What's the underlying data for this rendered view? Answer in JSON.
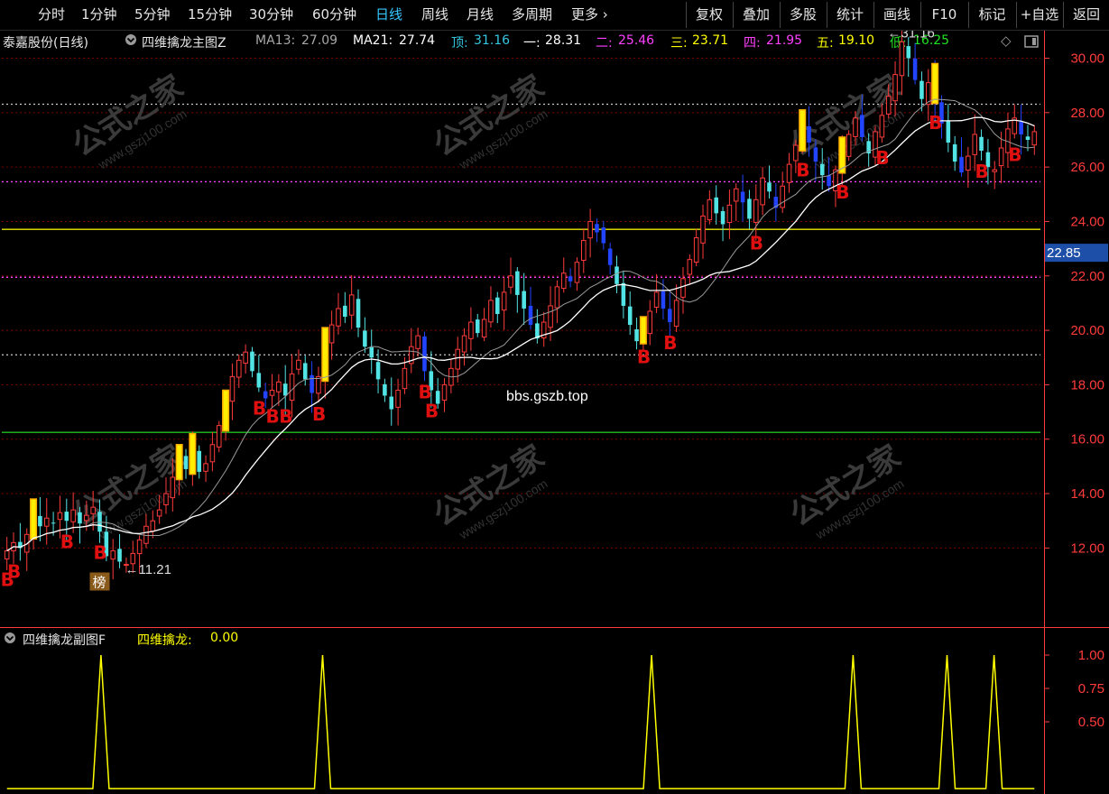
{
  "toolbar": {
    "periods": [
      "分时",
      "1分钟",
      "5分钟",
      "15分钟",
      "30分钟",
      "60分钟",
      "日线",
      "周线",
      "月线",
      "多周期",
      "更多"
    ],
    "active_period": "日线",
    "right_buttons": [
      "复权",
      "叠加",
      "多股",
      "统计",
      "画线",
      "F10",
      "标记",
      "+自选",
      "返回"
    ]
  },
  "info": {
    "stock": "泰嘉股份(日线)",
    "indicator": "四维擒龙主图Z",
    "ma13_label": "MA13:",
    "ma13_value": "27.09",
    "ma21_label": "MA21:",
    "ma21_value": "27.74",
    "top_label": "顶:",
    "top_value": "31.16",
    "l1_label": "一:",
    "l1_value": "28.31",
    "l2_label": "二:",
    "l2_value": "25.46",
    "l3_label": "三:",
    "l3_value": "23.71",
    "l4_label": "四:",
    "l4_value": "21.95",
    "l5_label": "五:",
    "l5_value": "19.10",
    "low_label": "低:",
    "low_value": "16.25"
  },
  "colors": {
    "up": "#ff3b3b",
    "down_cyan": "#52e4e4",
    "down_blue": "#2244ff",
    "yellow_line": "#e8e800",
    "green_line": "#20c020",
    "cyan_line": "#35c6e0",
    "grid_red": "#7a0000",
    "ma13": "#dcdcdc",
    "ma21": "#ffffff",
    "signal": "#ffff00",
    "axis": "#ff3b3b"
  },
  "icons": {
    "collapse": "circle-chevron-icon",
    "diamond": "diamond-icon",
    "window": "window-icon"
  },
  "chart_data": [
    {
      "type": "candlestick",
      "title": "四维擒龙主图Z",
      "ylim": [
        11.0,
        31.5
      ],
      "y_ticks": [
        "12.00",
        "14.00",
        "16.00",
        "18.00",
        "20.00",
        "22.00",
        "24.00",
        "26.00",
        "28.00",
        "30.00"
      ],
      "current_price": "22.85",
      "high_annotation": "31.16",
      "low_annotation": "11.21",
      "watermark_main": "bbs.gszb.top",
      "watermark_logo": "公式之家",
      "watermark_url": "www.gszj100.com",
      "levels": [
        {
          "name": "顶",
          "value": 31.16
        },
        {
          "name": "一",
          "value": 28.31
        },
        {
          "name": "二",
          "value": 25.46
        },
        {
          "name": "三",
          "value": 23.71
        },
        {
          "name": "四",
          "value": 21.95
        },
        {
          "name": "五",
          "value": 19.1
        },
        {
          "name": "低",
          "value": 16.25
        }
      ],
      "b_signals": [
        0,
        1,
        9,
        14,
        38,
        40,
        42,
        47,
        63,
        64,
        96,
        100,
        113,
        120,
        126,
        132,
        140,
        147,
        152
      ],
      "bang_marker": "榜",
      "bang_index": 14,
      "closes": [
        11.9,
        12.2,
        12.0,
        12.5,
        13.2,
        12.8,
        13.1,
        12.9,
        13.3,
        13.0,
        13.4,
        12.9,
        13.2,
        13.5,
        12.6,
        11.7,
        11.9,
        11.5,
        11.4,
        11.8,
        12.3,
        12.8,
        13.0,
        13.4,
        14.0,
        14.6,
        15.2,
        14.9,
        15.6,
        14.8,
        15.1,
        15.8,
        16.5,
        17.2,
        18.3,
        18.9,
        19.2,
        18.5,
        17.9,
        17.5,
        17.8,
        18.1,
        17.6,
        18.4,
        18.9,
        18.2,
        17.7,
        18.3,
        19.5,
        20.2,
        20.8,
        20.5,
        21.3,
        20.1,
        19.4,
        19.0,
        18.2,
        17.6,
        17.1,
        17.8,
        18.6,
        19.4,
        19.8,
        18.5,
        17.8,
        17.3,
        18.0,
        18.6,
        19.3,
        19.8,
        20.3,
        19.9,
        20.4,
        21.1,
        20.6,
        21.4,
        22.0,
        21.3,
        20.8,
        20.2,
        19.7,
        20.3,
        20.9,
        21.6,
        22.1,
        21.8,
        22.5,
        23.3,
        24.0,
        23.6,
        23.2,
        22.4,
        21.7,
        20.9,
        20.2,
        19.6,
        19.9,
        20.7,
        21.4,
        20.8,
        20.3,
        21.1,
        21.9,
        22.6,
        23.4,
        24.2,
        24.8,
        24.3,
        23.9,
        24.6,
        25.2,
        24.7,
        24.1,
        24.8,
        25.6,
        25.1,
        24.5,
        25.3,
        26.1,
        26.8,
        27.5,
        26.9,
        26.2,
        25.7,
        25.3,
        25.9,
        26.5,
        27.2,
        27.8,
        27.1,
        26.5,
        27.3,
        27.9,
        28.6,
        29.4,
        30.6,
        30.0,
        29.2,
        28.5,
        29.1,
        28.4,
        27.6,
        26.9,
        26.2,
        25.8,
        26.4,
        27.2,
        26.6,
        26.0,
        25.9,
        26.7,
        27.4,
        27.8,
        27.2,
        27.0,
        27.3
      ]
    },
    {
      "type": "line",
      "title": "四维擒龙副图F",
      "series_label": "四维擒龙:",
      "series_value": "0.00",
      "ylim": [
        0,
        1.1
      ],
      "y_ticks": [
        "1.00",
        "0.75",
        "0.50"
      ],
      "spikes_at": [
        14,
        47,
        96,
        126,
        140,
        147
      ],
      "length": 154
    }
  ]
}
